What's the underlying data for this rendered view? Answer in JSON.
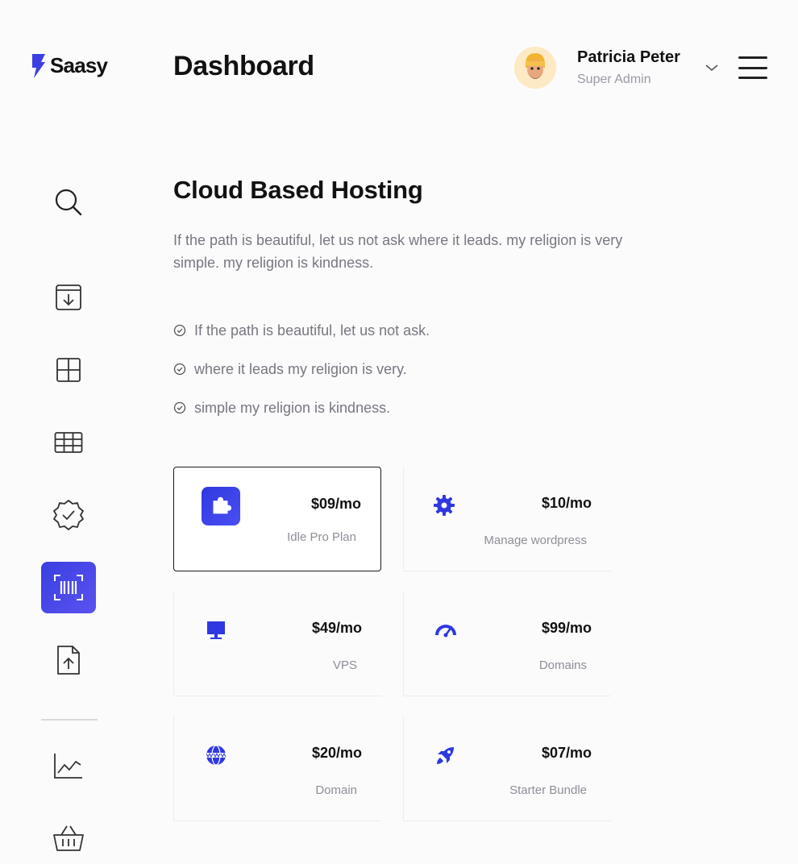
{
  "brand": {
    "name": "Saasy",
    "accent": "#3b3fe4"
  },
  "header": {
    "title": "Dashboard"
  },
  "user": {
    "name": "Patricia Peter",
    "role": "Super Admin",
    "menu_icon": "hamburger-icon"
  },
  "sidebar": {
    "items": [
      {
        "icon": "search-icon",
        "active": false
      },
      {
        "icon": "download-box-icon",
        "active": false
      },
      {
        "icon": "layout-grid-icon",
        "active": false
      },
      {
        "icon": "table-icon",
        "active": false
      },
      {
        "icon": "verified-badge-icon",
        "active": false
      },
      {
        "icon": "barcode-scan-icon",
        "active": true
      },
      {
        "icon": "file-upload-icon",
        "active": false
      },
      {
        "icon": "chart-line-icon",
        "active": false
      },
      {
        "icon": "basket-icon",
        "active": false
      }
    ]
  },
  "hosting": {
    "title": "Cloud Based Hosting",
    "description": "If the path is beautiful, let us not ask where it leads. my religion is very simple. my religion is kindness.",
    "features": [
      "If the path is beautiful, let us not ask.",
      "where it leads my religion is very.",
      "simple my religion is kindness."
    ]
  },
  "plans": [
    {
      "price": "$09/mo",
      "name": "Idle Pro Plan",
      "icon": "puzzle-icon",
      "selected": true
    },
    {
      "price": "$10/mo",
      "name": "Manage wordpress",
      "icon": "gear-icon",
      "selected": false
    },
    {
      "price": "$49/mo",
      "name": "VPS",
      "icon": "monitor-icon",
      "selected": false
    },
    {
      "price": "$99/mo",
      "name": "Domains",
      "icon": "speedometer-icon",
      "selected": false
    },
    {
      "price": "$20/mo",
      "name": "Domain",
      "icon": "globe-www-icon",
      "selected": false
    },
    {
      "price": "$07/mo",
      "name": "Starter Bundle",
      "icon": "rocket-icon",
      "selected": false
    }
  ]
}
